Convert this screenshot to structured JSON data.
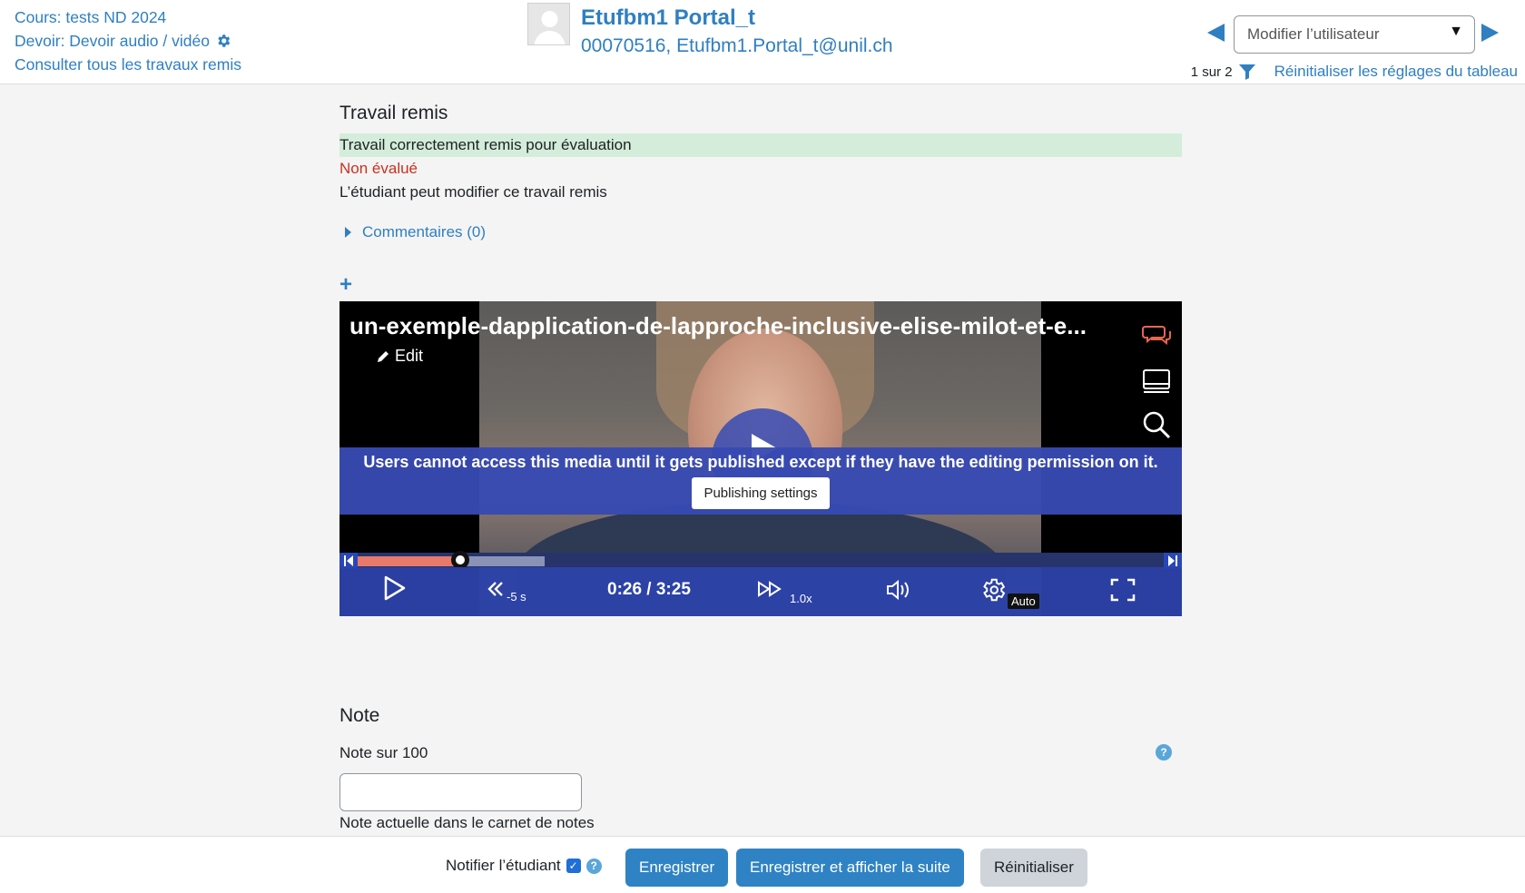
{
  "header": {
    "course_link": "Cours: tests ND 2024",
    "assignment_link": "Devoir: Devoir audio / vidéo",
    "view_all_link": "Consulter tous les travaux remis",
    "user_name": "Etufbm1 Portal_t",
    "user_meta": "00070516, Etufbm1.Portal_t@unil.ch",
    "user_select_placeholder": "Modifier l’utilisateur",
    "pager": "1 sur 2",
    "reset_table": "Réinitialiser les réglages du tableau"
  },
  "submission": {
    "title": "Travail remis",
    "status_submitted": "Travail correctement remis pour évaluation",
    "status_grading": "Non évalué",
    "status_editable": "L’étudiant peut modifier ce travail remis",
    "comments_label": "Commentaires (0)",
    "add_symbol": "+"
  },
  "player": {
    "title": "un-exemple-dapplication-de-lapproche-inclusive-elise-milot-et-e...",
    "edit_label": "Edit",
    "publish_message": "Users cannot access this media until it gets published except if they have the editing permission on it.",
    "publish_button": "Publishing settings",
    "skip_back_label": "-5 s",
    "time": "0:26 / 3:25",
    "speed": "1.0x",
    "quality": "Auto",
    "progress_played": 0.127,
    "progress_buffered": 0.232
  },
  "grade": {
    "title": "Note",
    "label": "Note sur 100",
    "current_label": "Note actuelle dans le carnet de notes",
    "value": "",
    "help_symbol": "?"
  },
  "footer": {
    "notify_label": "Notifier l’étudiant",
    "save_label": "Enregistrer",
    "save_next_label": "Enregistrer et afficher la suite",
    "reset_label": "Réinitialiser"
  }
}
